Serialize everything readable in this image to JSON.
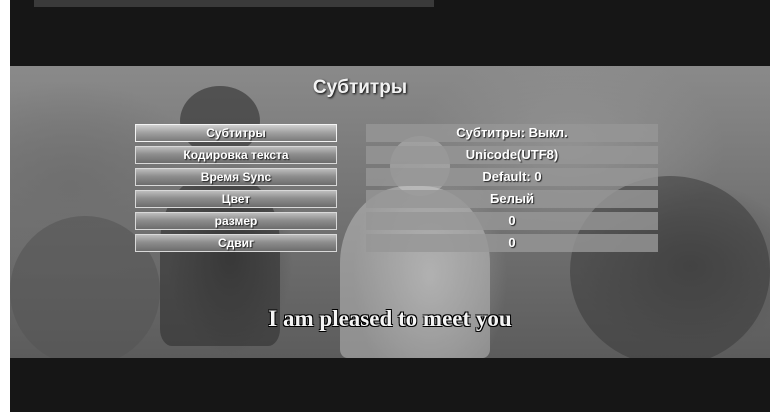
{
  "screen": {
    "title": "Субтитры",
    "caption": "I am pleased to meet you"
  },
  "menu": {
    "items": [
      {
        "label": "Субтитры",
        "value": "Субтитры:  Выкл.",
        "selected": true
      },
      {
        "label": "Кодировка текста",
        "value": "Unicode(UTF8)"
      },
      {
        "label": "Время Sync",
        "value": "Default: 0"
      },
      {
        "label": "Цвет",
        "value": "Белый"
      },
      {
        "label": "размер",
        "value": "0"
      },
      {
        "label": "Сдвиг",
        "value": "0"
      }
    ]
  }
}
